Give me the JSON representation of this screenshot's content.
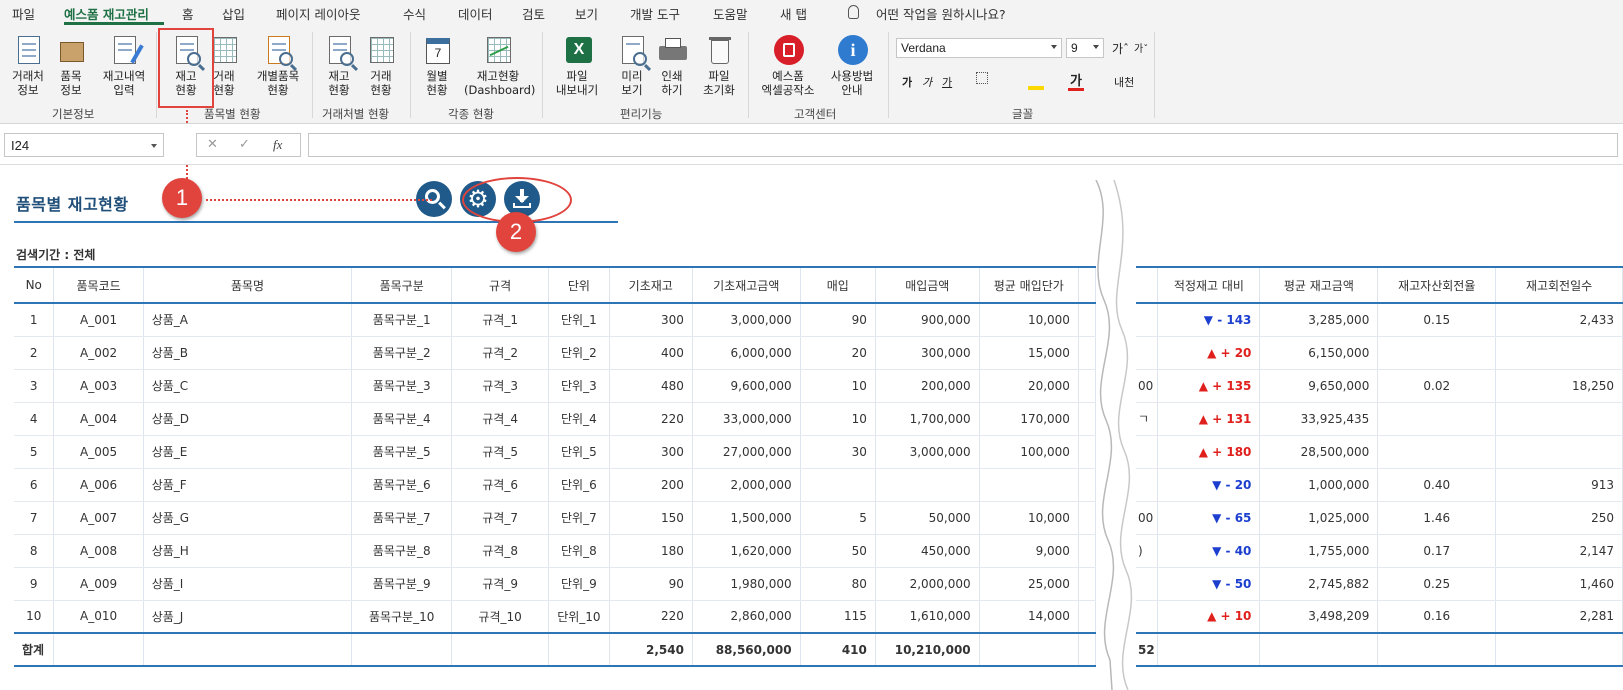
{
  "ribbon_tabs": [
    "파일",
    "예스폼 재고관리",
    "홈",
    "삽입",
    "페이지 레이아웃",
    "수식",
    "데이터",
    "검토",
    "보기",
    "개발 도구",
    "도움말",
    "새 탭"
  ],
  "tell_me": "어떤 작업을 원하시나요?",
  "ribbon": {
    "btn_customer_info": "거래처\n정보",
    "btn_item_info": "품목\n정보",
    "btn_inventory_input": "재고내역\n입력",
    "btn_stock_status": "재고\n현황",
    "btn_trade_status": "거래\n현황",
    "btn_single_item_status": "개별품목\n현황",
    "btn_customer_stock_status": "재고\n현황",
    "btn_customer_trade_status": "거래\n현황",
    "btn_monthly_status": "월별\n현황",
    "btn_dashboard": "재고현황\n(Dashboard)",
    "btn_file_export": "파일\n내보내기",
    "btn_preview": "미리\n보기",
    "btn_print": "인쇄\n하기",
    "btn_file_reset": "파일\n초기화",
    "btn_yesform_workshop": "예스폼\n엑셀공작소",
    "btn_usage_guide": "사용방법\n안내",
    "group_basic": "기본정보",
    "group_by_item": "품목별 현황",
    "group_by_customer": "거래처별 현황",
    "group_various": "각종 현황",
    "group_convenience": "편리기능",
    "group_support": "고객센터",
    "group_font": "글꼴",
    "calendar_day": "7",
    "font_name": "Verdana",
    "font_size": "9"
  },
  "formula_bar": {
    "name_box": "I24",
    "fx": "fx"
  },
  "sheet": {
    "title": "품목별 재고현황",
    "period": "검색기간 : 전체",
    "annotation_1": "1",
    "annotation_2": "2"
  },
  "table_left": {
    "headers": [
      "No",
      "품목코드",
      "품목명",
      "품목구분",
      "규격",
      "단위",
      "기초재고",
      "기초재고금액",
      "매입",
      "매입금액",
      "평균 매입단가",
      ""
    ],
    "rows": [
      [
        "1",
        "A_001",
        "상품_A",
        "품목구분_1",
        "규격_1",
        "단위_1",
        "300",
        "3,000,000",
        "90",
        "900,000",
        "10,000",
        ""
      ],
      [
        "2",
        "A_002",
        "상품_B",
        "품목구분_2",
        "규격_2",
        "단위_2",
        "400",
        "6,000,000",
        "20",
        "300,000",
        "15,000",
        ""
      ],
      [
        "3",
        "A_003",
        "상품_C",
        "품목구분_3",
        "규격_3",
        "단위_3",
        "480",
        "9,600,000",
        "10",
        "200,000",
        "20,000",
        ""
      ],
      [
        "4",
        "A_004",
        "상품_D",
        "품목구분_4",
        "규격_4",
        "단위_4",
        "220",
        "33,000,000",
        "10",
        "1,700,000",
        "170,000",
        ""
      ],
      [
        "5",
        "A_005",
        "상품_E",
        "품목구분_5",
        "규격_5",
        "단위_5",
        "300",
        "27,000,000",
        "30",
        "3,000,000",
        "100,000",
        ""
      ],
      [
        "6",
        "A_006",
        "상품_F",
        "품목구분_6",
        "규격_6",
        "단위_6",
        "200",
        "2,000,000",
        "",
        "",
        "",
        ""
      ],
      [
        "7",
        "A_007",
        "상품_G",
        "품목구분_7",
        "규격_7",
        "단위_7",
        "150",
        "1,500,000",
        "5",
        "50,000",
        "10,000",
        ""
      ],
      [
        "8",
        "A_008",
        "상품_H",
        "품목구분_8",
        "규격_8",
        "단위_8",
        "180",
        "1,620,000",
        "50",
        "450,000",
        "9,000",
        ""
      ],
      [
        "9",
        "A_009",
        "상품_I",
        "품목구분_9",
        "규격_9",
        "단위_9",
        "90",
        "1,980,000",
        "80",
        "2,000,000",
        "25,000",
        ""
      ],
      [
        "10",
        "A_010",
        "상품_J",
        "품목구분_10",
        "규격_10",
        "단위_10",
        "220",
        "2,860,000",
        "115",
        "1,610,000",
        "14,000",
        ""
      ]
    ],
    "total": [
      "합계",
      "",
      "",
      "",
      "",
      "",
      "2,540",
      "88,560,000",
      "410",
      "10,210,000",
      "",
      ""
    ]
  },
  "table_right": {
    "headers": [
      "",
      "적정재고 대비",
      "평균 재고금액",
      "재고자산회전율",
      "재고회전일수"
    ],
    "rows": [
      [
        "",
        "▼ - 143",
        "3,285,000",
        "0.15",
        "2,433"
      ],
      [
        "",
        "▲ + 20",
        "6,150,000",
        "",
        ""
      ],
      [
        "00",
        "▲ + 135",
        "9,650,000",
        "0.02",
        "18,250"
      ],
      [
        "ㄱ",
        "▲ + 131",
        "33,925,435",
        "",
        ""
      ],
      [
        "",
        "▲ + 180",
        "28,500,000",
        "",
        ""
      ],
      [
        "",
        "▼ - 20",
        "1,000,000",
        "0.40",
        "913"
      ],
      [
        "00",
        "▼ - 65",
        "1,025,000",
        "1.46",
        "250"
      ],
      [
        ")",
        "▼ - 40",
        "1,755,000",
        "0.17",
        "2,147"
      ],
      [
        "",
        "▼ - 50",
        "2,745,882",
        "0.25",
        "1,460"
      ],
      [
        "",
        "▲ + 10",
        "3,498,209",
        "0.16",
        "2,281"
      ]
    ],
    "row_trend": [
      "down",
      "up",
      "up",
      "up",
      "up",
      "down",
      "down",
      "down",
      "down",
      "up"
    ],
    "total": [
      "52",
      "",
      "",
      "",
      ""
    ]
  },
  "colors": {
    "accent": "#1e7145",
    "header_line": "#2e75b6",
    "title": "#1f4e79",
    "annotation": "#e0443c",
    "up": "#e0201c",
    "down": "#1c3fd0",
    "action_button": "#1f5a8a"
  },
  "icons": [
    "search-icon",
    "gear-icon",
    "download-icon",
    "lightbulb-icon",
    "excel-icon",
    "printer-icon",
    "recycle-bin-icon",
    "info-icon",
    "calendar-icon"
  ]
}
